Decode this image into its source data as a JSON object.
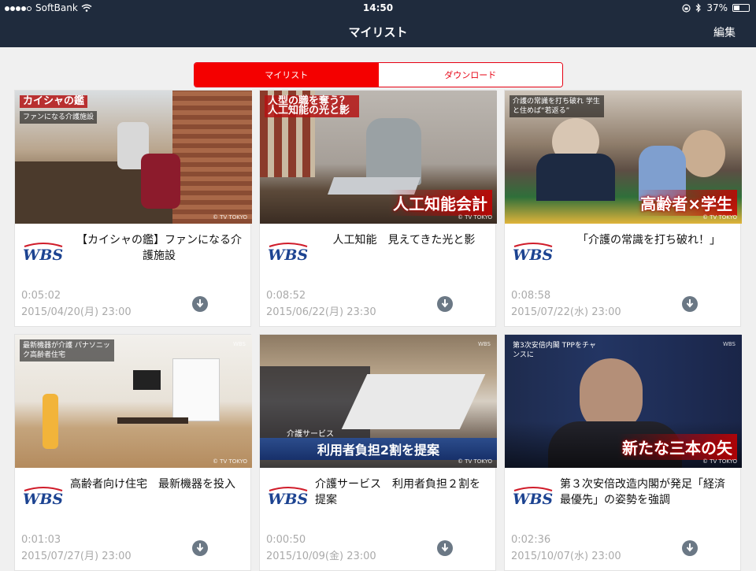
{
  "status": {
    "carrier": "SoftBank",
    "time": "14:50",
    "battery": "37%"
  },
  "nav": {
    "title": "マイリスト",
    "edit_label": "編集"
  },
  "segments": [
    {
      "label": "マイリスト"
    },
    {
      "label": "ダウンロード"
    }
  ],
  "colors": {
    "bar": "#1f2b3d",
    "accent": "#e60012",
    "meta_text": "#aaaaaa"
  },
  "logo_text": "WBS",
  "items": [
    {
      "title": "【カイシャの鑑】ファンになる介護施設",
      "duration": "0:05:02",
      "date": "2015/04/20(月) 23:00",
      "thumb_tag": "カイシャの鑑",
      "thumb_sub": "ファンになる介護施設",
      "thumb_caption": "",
      "icon": "download-icon"
    },
    {
      "title": "人工知能　見えてきた光と影",
      "duration": "0:08:52",
      "date": "2015/06/22(月) 23:30",
      "thumb_tag": "人型の職を奪う？ 人工知能の光と影",
      "thumb_sub": "",
      "thumb_caption": "人工知能会計",
      "icon": "download-icon"
    },
    {
      "title": "「介護の常識を打ち破れ！」",
      "duration": "0:08:58",
      "date": "2015/07/22(水) 23:00",
      "thumb_tag": "介護の常識を打ち破れ 学生と住めば“若返る”",
      "thumb_sub": "",
      "thumb_caption": "高齢者×学生",
      "icon": "download-icon"
    },
    {
      "title": "高齢者向け住宅　最新機器を投入",
      "duration": "0:01:03",
      "date": "2015/07/27(月) 23:00",
      "thumb_tag": "最新機器が介護 パナソニック高齢者住宅",
      "thumb_sub": "",
      "thumb_caption": "",
      "icon": "download-icon"
    },
    {
      "title": "介護サービス　利用者負担２割を提案",
      "duration": "0:00:50",
      "date": "2015/10/09(金) 23:00",
      "thumb_tag": "介護サービス",
      "thumb_sub": "",
      "thumb_caption": "利用者負担2割を提案",
      "icon": "download-icon"
    },
    {
      "title": "第３次安倍改造内閣が発足「経済最優先」の姿勢を強調",
      "duration": "0:02:36",
      "date": "2015/10/07(水) 23:00",
      "thumb_tag": "第3次安倍内閣 TPPをチャンスに",
      "thumb_sub": "",
      "thumb_caption": "新たな三本の矢",
      "icon": "download-icon"
    }
  ],
  "watermark": "© TV TOKYO"
}
